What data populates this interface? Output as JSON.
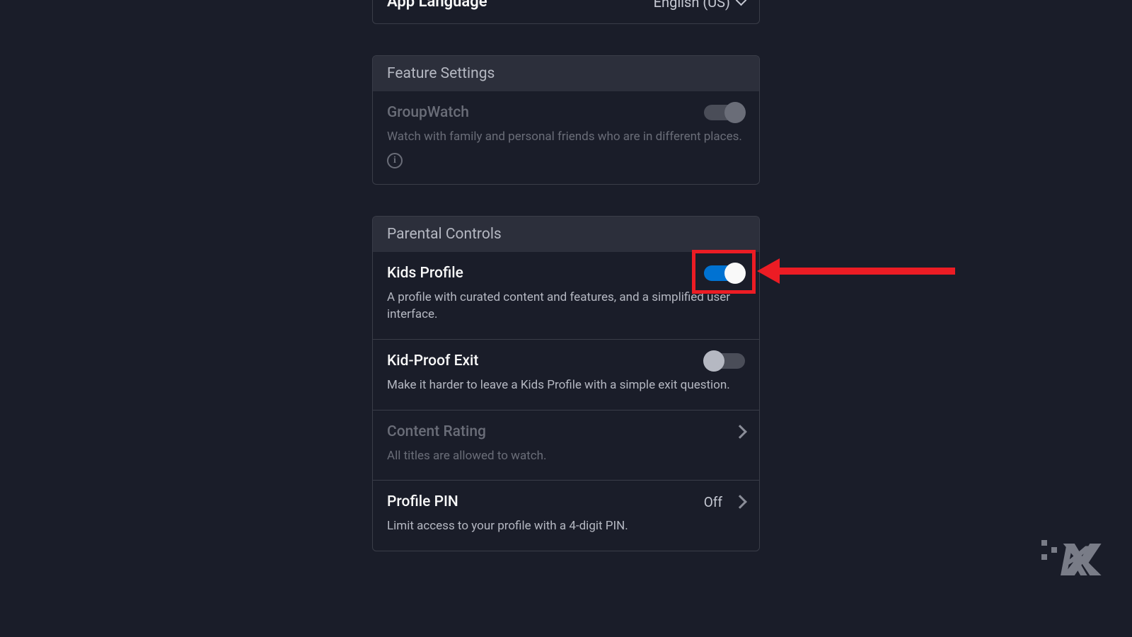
{
  "appLanguage": {
    "label": "App Language",
    "value": "English (US)"
  },
  "featureSettings": {
    "header": "Feature Settings",
    "groupWatch": {
      "title": "GroupWatch",
      "desc": "Watch with family and personal friends who are in different places."
    }
  },
  "parentalControls": {
    "header": "Parental Controls",
    "kidsProfile": {
      "title": "Kids Profile",
      "desc": "A profile with curated content and features, and a simplified user interface."
    },
    "kidProofExit": {
      "title": "Kid-Proof Exit",
      "desc": "Make it harder to leave a Kids Profile with a simple exit question."
    },
    "contentRating": {
      "title": "Content Rating",
      "desc": "All titles are allowed to watch."
    },
    "profilePin": {
      "title": "Profile PIN",
      "value": "Off",
      "desc": "Limit access to your profile with a 4-digit PIN."
    }
  }
}
